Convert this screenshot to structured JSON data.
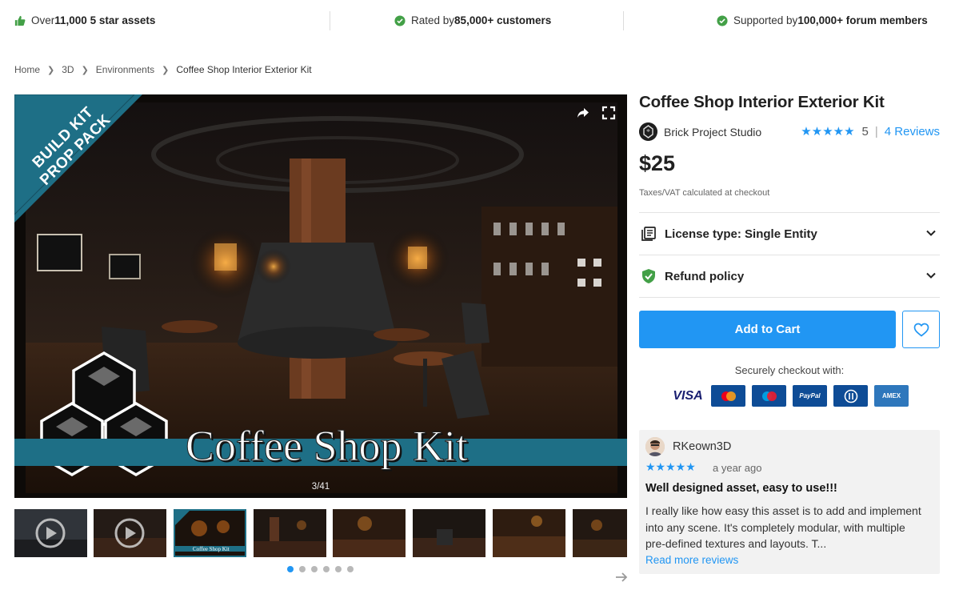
{
  "trust_bar": {
    "item1_prefix": "Over ",
    "item1_bold": "11,000 5 star assets",
    "item2_prefix": "Rated by ",
    "item2_bold": "85,000+ customers",
    "item3_prefix": "Supported by ",
    "item3_bold": "100,000+ forum members"
  },
  "breadcrumb": [
    "Home",
    "3D",
    "Environments",
    "Coffee Shop Interior Exterior Kit"
  ],
  "gallery": {
    "badge_line1": "BUILD KIT",
    "badge_line2": "PROP PACK",
    "title_text": "Coffee Shop Kit",
    "counter": "3/41",
    "thumb3_caption": "Coffee Shop Kit",
    "dots_total": 6,
    "dots_active": 0
  },
  "product": {
    "title": "Coffee Shop Interior Exterior Kit",
    "publisher": "Brick Project Studio",
    "stars": "★★★★★",
    "rating_value": "5",
    "reviews_link": "4 Reviews",
    "price": "$25",
    "tax_note": "Taxes/VAT calculated at checkout",
    "license_label": "License type: Single Entity",
    "refund_label": "Refund policy",
    "add_to_cart": "Add to Cart",
    "secure_checkout": "Securely checkout with:",
    "payment_methods": [
      "VISA",
      "Mastercard",
      "Maestro",
      "PayPal",
      "Diners",
      "AMEX"
    ]
  },
  "review": {
    "author": "RKeown3D",
    "stars": "★★★★★",
    "date": "a year ago",
    "title": "Well designed asset, easy to use!!!",
    "body": "I really like how easy this asset is to add and implement into any scene.  It's completely modular, with multiple pre-defined textures and layouts.  T...",
    "more_link": "Read more reviews"
  },
  "colors": {
    "accent": "#2196f3",
    "verified_green": "#43a047",
    "badge_teal": "#1e6f86"
  }
}
